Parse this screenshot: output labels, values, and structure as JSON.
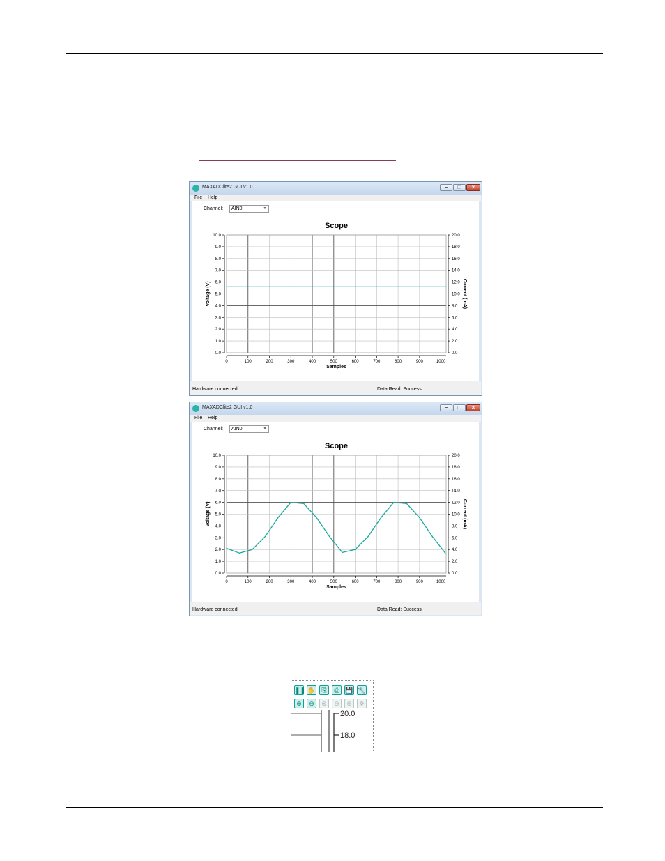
{
  "windows": [
    {
      "title": "MAXADClite2 GUI v1.0",
      "menu": [
        "File",
        "Help"
      ],
      "channel_label": "Channel:",
      "channel_value": "AIN0",
      "status_left": "Hardware connected",
      "status_right": "Data Read: Success",
      "chart_title": "Scope",
      "xlabel": "Samples",
      "ylabel_left": "Voltage (V)",
      "ylabel_right": "Current (mA)",
      "x_ticks": [
        "0",
        "100",
        "200",
        "300",
        "400",
        "500",
        "600",
        "700",
        "800",
        "900",
        "1000"
      ],
      "y_ticks_left": [
        "0.0",
        "1.0",
        "2.0",
        "3.0",
        "4.0",
        "5.0",
        "6.0",
        "7.0",
        "8.0",
        "9.0",
        "10.0"
      ],
      "y_ticks_right": [
        "0.0",
        "2.0",
        "4.0",
        "6.0",
        "8.0",
        "10.0",
        "12.0",
        "14.0",
        "16.0",
        "18.0",
        "20.0"
      ]
    },
    {
      "title": "MAXADClite2 GUI v1.0",
      "menu": [
        "File",
        "Help"
      ],
      "channel_label": "Channel:",
      "channel_value": "AIN0",
      "status_left": "Hardware connected",
      "status_right": "Data Read: Success",
      "chart_title": "Scope",
      "xlabel": "Samples",
      "ylabel_left": "Voltage (V)",
      "ylabel_right": "Current (mA)",
      "x_ticks": [
        "0",
        "100",
        "200",
        "300",
        "400",
        "500",
        "600",
        "700",
        "800",
        "900",
        "1000"
      ],
      "y_ticks_left": [
        "0.0",
        "1.0",
        "2.0",
        "3.0",
        "4.0",
        "5.0",
        "6.0",
        "7.0",
        "8.0",
        "9.0",
        "10.0"
      ],
      "y_ticks_right": [
        "0.0",
        "2.0",
        "4.0",
        "6.0",
        "8.0",
        "10.0",
        "12.0",
        "14.0",
        "16.0",
        "18.0",
        "20.0"
      ]
    }
  ],
  "chart_data": [
    {
      "type": "line",
      "title": "Scope",
      "xlabel": "Samples",
      "ylabel": "Voltage (V)",
      "ylabel_right": "Current (mA)",
      "xlim": [
        0,
        1024
      ],
      "ylim": [
        0,
        10
      ],
      "ylim_right": [
        0,
        20
      ],
      "grid": true,
      "color": "#1aa8a0",
      "series": [
        {
          "x": [
            0,
            1024
          ],
          "y": [
            5.6,
            5.6
          ]
        }
      ]
    },
    {
      "type": "line",
      "title": "Scope",
      "xlabel": "Samples",
      "ylabel": "Voltage (V)",
      "ylabel_right": "Current (mA)",
      "xlim": [
        0,
        1024
      ],
      "ylim": [
        0,
        10
      ],
      "ylim_right": [
        0,
        20
      ],
      "grid": true,
      "color": "#1aa8a0",
      "series": [
        {
          "x": [
            0,
            60,
            120,
            180,
            240,
            300,
            360,
            420,
            480,
            540,
            600,
            660,
            720,
            780,
            840,
            900,
            960,
            1020
          ],
          "y": [
            2.1,
            1.7,
            2.0,
            3.1,
            4.7,
            6.0,
            5.9,
            4.7,
            3.1,
            1.75,
            2.0,
            3.1,
            4.7,
            6.0,
            5.9,
            4.7,
            3.1,
            1.7
          ]
        }
      ]
    }
  ],
  "zoom_toolbar": {
    "buttons_row1": [
      "pause-icon",
      "hand-icon",
      "copy-icon",
      "print-icon",
      "save-icon",
      "wrench-icon"
    ],
    "buttons_row2": [
      "zoom-in-icon",
      "zoom-out-icon",
      "zoom-reset-icon",
      "zoom-x-icon",
      "zoom-y-icon",
      "pan-icon"
    ],
    "glyphs_row1": [
      "❚❚",
      "✋",
      "⎘",
      "⎙",
      "💾",
      "🔧"
    ],
    "glyphs_row2": [
      "⊕",
      "⊖",
      "⊗",
      "⊖",
      "⊕",
      "✥"
    ],
    "axis_labels": [
      "20.0",
      "18.0"
    ]
  }
}
